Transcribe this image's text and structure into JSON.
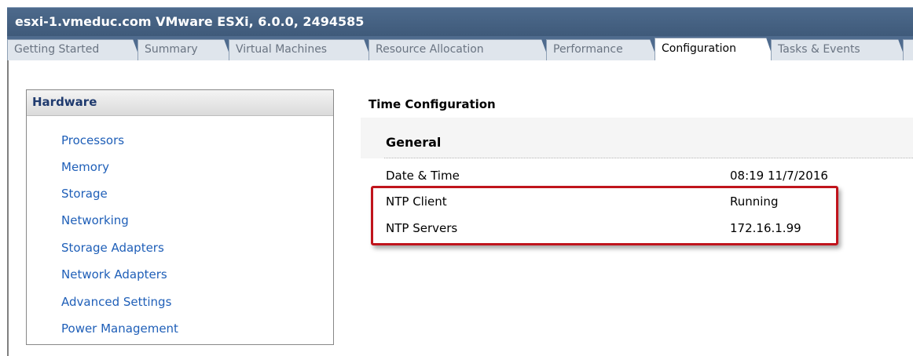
{
  "window": {
    "title": "esxi-1.vmeduc.com VMware ESXi, 6.0.0, 2494585"
  },
  "tabs": [
    {
      "label": "Getting Started"
    },
    {
      "label": "Summary"
    },
    {
      "label": "Virtual Machines"
    },
    {
      "label": "Resource Allocation"
    },
    {
      "label": "Performance"
    },
    {
      "label": "Configuration",
      "active": true
    },
    {
      "label": "Tasks & Events"
    }
  ],
  "hardware": {
    "header": "Hardware",
    "items": [
      {
        "label": "Processors"
      },
      {
        "label": "Memory"
      },
      {
        "label": "Storage"
      },
      {
        "label": "Networking"
      },
      {
        "label": "Storage Adapters"
      },
      {
        "label": "Network Adapters"
      },
      {
        "label": "Advanced Settings"
      },
      {
        "label": "Power Management"
      }
    ]
  },
  "time_config": {
    "title": "Time Configuration",
    "section": "General",
    "rows": [
      {
        "label": "Date & Time",
        "value": "08:19  11/7/2016"
      },
      {
        "label": "NTP Client",
        "value": "Running"
      },
      {
        "label": "NTP Servers",
        "value": "172.16.1.99"
      }
    ]
  },
  "colors": {
    "titlebar": "#4d6a8c",
    "link": "#1f5fb8",
    "highlight": "#c0141c"
  }
}
